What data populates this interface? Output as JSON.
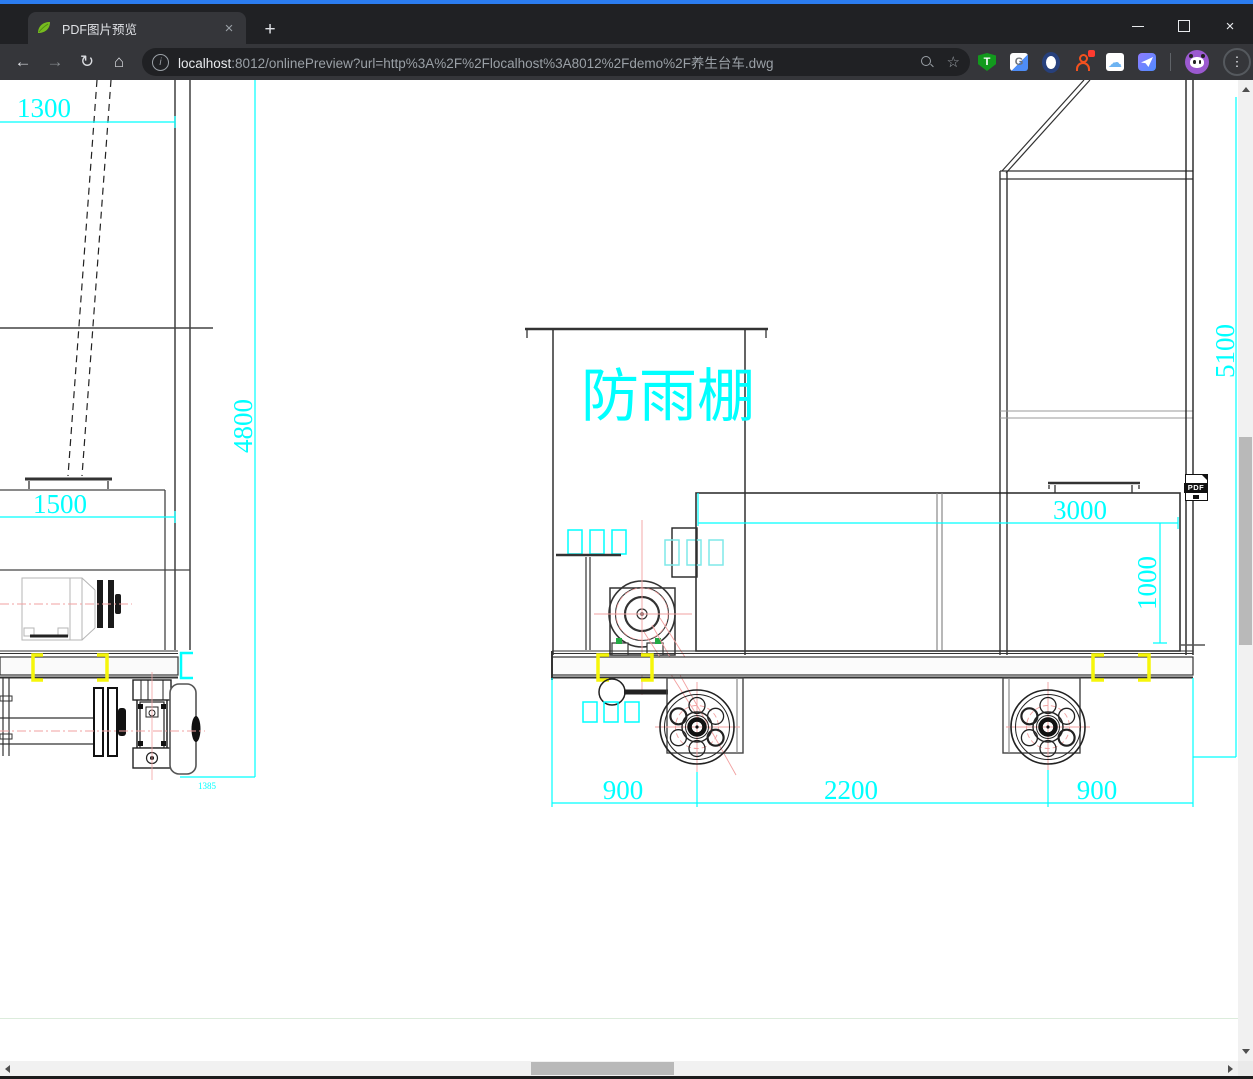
{
  "window": {
    "close_glyph": "×"
  },
  "tabbar": {
    "tab_title": "PDF图片预览",
    "tab_close": "×",
    "new_tab": "+"
  },
  "toolbar": {
    "back": "←",
    "forward": "→",
    "reload": "↻",
    "home": "⌂",
    "info_badge": "i",
    "url_host": "localhost",
    "url_rest": ":8012/onlinePreview?url=http%3A%2F%2Flocalhost%3A8012%2Fdemo%2F养生台车.dwg",
    "star": "☆",
    "menu": "⋮",
    "extensions": {
      "tampermonkey_letter": "T",
      "translate_letter": "G",
      "cloud_glyph": "☁"
    }
  },
  "drawing": {
    "shed_label": "防雨棚",
    "pdf_badge": "PDF",
    "dims": {
      "w1300": "1300",
      "h4800": "4800",
      "w1500": "1500",
      "w1385": "1385",
      "h5100": "5100",
      "w3000": "3000",
      "h1000": "1000",
      "w900l": "900",
      "w2200": "2200",
      "w900r": "900"
    },
    "colors": {
      "dimension": "#00ffff",
      "clamp": "#f6f60a",
      "centerline": "#f2a0a0",
      "line": "#1c1c1c"
    }
  }
}
